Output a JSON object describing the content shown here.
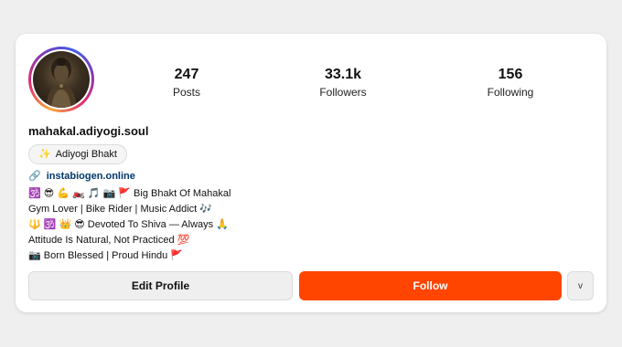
{
  "profile": {
    "username": "mahakal.adiyogi.soul",
    "badge": {
      "icon": "sparkles-icon",
      "icon_glyph": "✨",
      "label": "Adiyogi Bhakt"
    },
    "link": {
      "icon": "link-icon",
      "icon_glyph": "🔗",
      "text": "instabiogen.online"
    },
    "bio_lines": [
      "🕉️ 😎 💪 🏍️ 🎵 📷 🚩 Big Bhakt Of Mahakal",
      "Gym Lover | Bike Rider | Music Addict 🎶",
      "🔱 🕉️ 👑 😎 Devoted To Shiva — Always 🙏",
      "Attitude Is Natural, Not Practiced 💯",
      "📷 Born Blessed | Proud Hindu 🚩"
    ]
  },
  "stats": {
    "posts": {
      "value": "247",
      "label": "Posts"
    },
    "followers": {
      "value": "33.1k",
      "label": "Followers"
    },
    "following": {
      "value": "156",
      "label": "Following"
    }
  },
  "actions": {
    "edit_label": "Edit Profile",
    "follow_label": "Follow",
    "more_label": "v"
  },
  "colors": {
    "follow_bg": "#ff4500",
    "link": "#00376b",
    "page_bg": "#efefef"
  }
}
